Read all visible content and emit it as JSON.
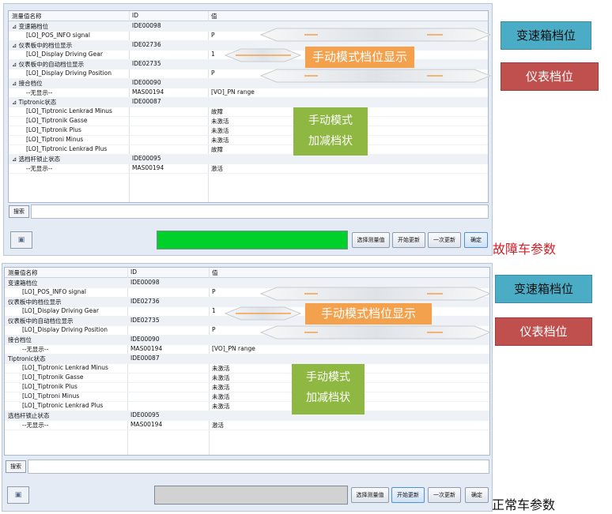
{
  "headers": {
    "name": "测量值名称",
    "id": "ID",
    "value": "值"
  },
  "panel1": {
    "rows": [
      {
        "name": "⊿ 变速箱档位",
        "id": "IDE00098",
        "value": "",
        "group": true
      },
      {
        "name": "[LO]_POS_INFO signal",
        "id": "",
        "value": "P",
        "indent": true
      },
      {
        "name": "⊿ 仪表板中的档位显示",
        "id": "IDE02736",
        "value": "",
        "group": true
      },
      {
        "name": "[LO]_Display Driving Gear",
        "id": "",
        "value": "1",
        "indent": true
      },
      {
        "name": "⊿ 仪表板中的自动档位显示",
        "id": "IDE02735",
        "value": "",
        "group": true
      },
      {
        "name": "[LO]_Display Driving Position",
        "id": "",
        "value": "P",
        "indent": true
      },
      {
        "name": "⊿ 接合档位",
        "id": "IDE00090",
        "value": "",
        "group": true
      },
      {
        "name": "--无显示--",
        "id": "MAS00194",
        "value": "[VO]_PN range",
        "indent": true
      },
      {
        "name": "⊿ Tiptronic状态",
        "id": "IDE00087",
        "value": "",
        "group": true
      },
      {
        "name": "[LO]_Tiptronic Lenkrad Minus",
        "id": "",
        "value": "故障",
        "indent": true
      },
      {
        "name": "[LO]_Tiptronik Gasse",
        "id": "",
        "value": "未激活",
        "indent": true
      },
      {
        "name": "[LO]_Tiptronik Plus",
        "id": "",
        "value": "未激活",
        "indent": true
      },
      {
        "name": "[LO]_Tiptroni Minus",
        "id": "",
        "value": "未激活",
        "indent": true
      },
      {
        "name": "[LO]_Tiptronic Lenkrad Plus",
        "id": "",
        "value": "故障",
        "indent": true
      },
      {
        "name": "⊿ 选档杆锁止状态",
        "id": "IDE00095",
        "value": "",
        "group": true
      },
      {
        "name": "--无显示--",
        "id": "MAS00194",
        "value": "激活",
        "indent": true
      }
    ],
    "search_label": "搜索",
    "btn_select": "选择测量值",
    "btn_start": "开始更新",
    "btn_once": "一次更新",
    "btn_ok": "确定",
    "progress_color": "#00d12a",
    "caption": "故障车参数"
  },
  "panel2": {
    "rows": [
      {
        "name": "变速箱档位",
        "id": "IDE00098",
        "value": "",
        "group": true
      },
      {
        "name": "[LO]_POS_INFO signal",
        "id": "",
        "value": "P",
        "indent": true
      },
      {
        "name": "仪表板中的档位显示",
        "id": "IDE02736",
        "value": "",
        "group": true
      },
      {
        "name": "[LO]_Display Driving Gear",
        "id": "",
        "value": "1",
        "indent": true
      },
      {
        "name": "仪表板中的自动档位显示",
        "id": "IDE02735",
        "value": "",
        "group": true
      },
      {
        "name": "[LO]_Display Driving Position",
        "id": "",
        "value": "P",
        "indent": true
      },
      {
        "name": "接合档位",
        "id": "IDE00090",
        "value": "",
        "group": true
      },
      {
        "name": "--无显示--",
        "id": "MAS00194",
        "value": "[VO]_PN range",
        "indent": true
      },
      {
        "name": "Tiptronic状态",
        "id": "IDE00087",
        "value": "",
        "group": true
      },
      {
        "name": "[LO]_Tiptronic Lenkrad Minus",
        "id": "",
        "value": "未激活",
        "indent": true
      },
      {
        "name": "[LO]_Tiptronik Gasse",
        "id": "",
        "value": "未激活",
        "indent": true
      },
      {
        "name": "[LO]_Tiptronik Plus",
        "id": "",
        "value": "未激活",
        "indent": true
      },
      {
        "name": "[LO]_Tiptroni Minus",
        "id": "",
        "value": "未激活",
        "indent": true
      },
      {
        "name": "[LO]_Tiptronic Lenkrad Plus",
        "id": "",
        "value": "未激活",
        "indent": true
      },
      {
        "name": "选档杆锁止状态",
        "id": "IDE00095",
        "value": "",
        "group": true
      },
      {
        "name": "--无显示--",
        "id": "MAS00194",
        "value": "激活",
        "indent": true
      }
    ],
    "search_label": "搜索",
    "btn_select": "选择测量值",
    "btn_start": "开始更新",
    "btn_once": "一次更新",
    "btn_ok": "确定",
    "progress_color": "#d2d2d2",
    "caption": "正常车参数"
  },
  "annotations": {
    "manual_gear_display": "手动模式档位显示",
    "manual_updown_line1": "手动模式",
    "manual_updown_line2": "加减档状",
    "gearbox_position": "变速箱档位",
    "cluster_position": "仪表档位"
  },
  "colors": {
    "orange_callout": "#f4a14d",
    "green_callout": "#8fb842",
    "blue_label": "#4bacc6",
    "red_label": "#c0504d",
    "caption_red": "#d0202a"
  },
  "icons": {
    "tool_button": "device-icon"
  }
}
